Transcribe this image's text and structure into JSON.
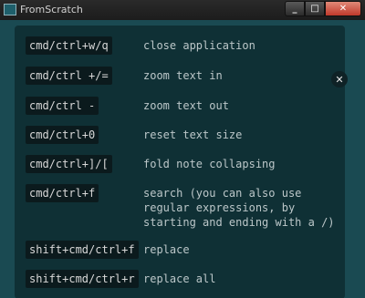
{
  "window": {
    "title": "FromScratch"
  },
  "titlebar_buttons": {
    "minimize": "_",
    "maximize": "□",
    "close": "✕"
  },
  "overlay": {
    "close_label": "✕"
  },
  "shortcuts": [
    {
      "keys": "cmd/ctrl+w/q",
      "action": "close application"
    },
    {
      "keys": "cmd/ctrl +/=",
      "action": "zoom text in"
    },
    {
      "keys": "cmd/ctrl -",
      "action": "zoom text out"
    },
    {
      "keys": "cmd/ctrl+0",
      "action": "reset text size"
    },
    {
      "keys": "cmd/ctrl+]/[",
      "action": "fold note collapsing"
    },
    {
      "keys": "cmd/ctrl+f",
      "action": "search (you can also use regular expressions, by starting and ending with a /)"
    },
    {
      "keys": "shift+cmd/ctrl+f",
      "action": "replace"
    },
    {
      "keys": "shift+cmd/ctrl+r",
      "action": "replace all"
    }
  ],
  "colors": {
    "client_background": "#1a4a52",
    "overlay_background": "#0e2c31",
    "key_background": "#0b1a1d",
    "close_button": "#c0392b"
  }
}
